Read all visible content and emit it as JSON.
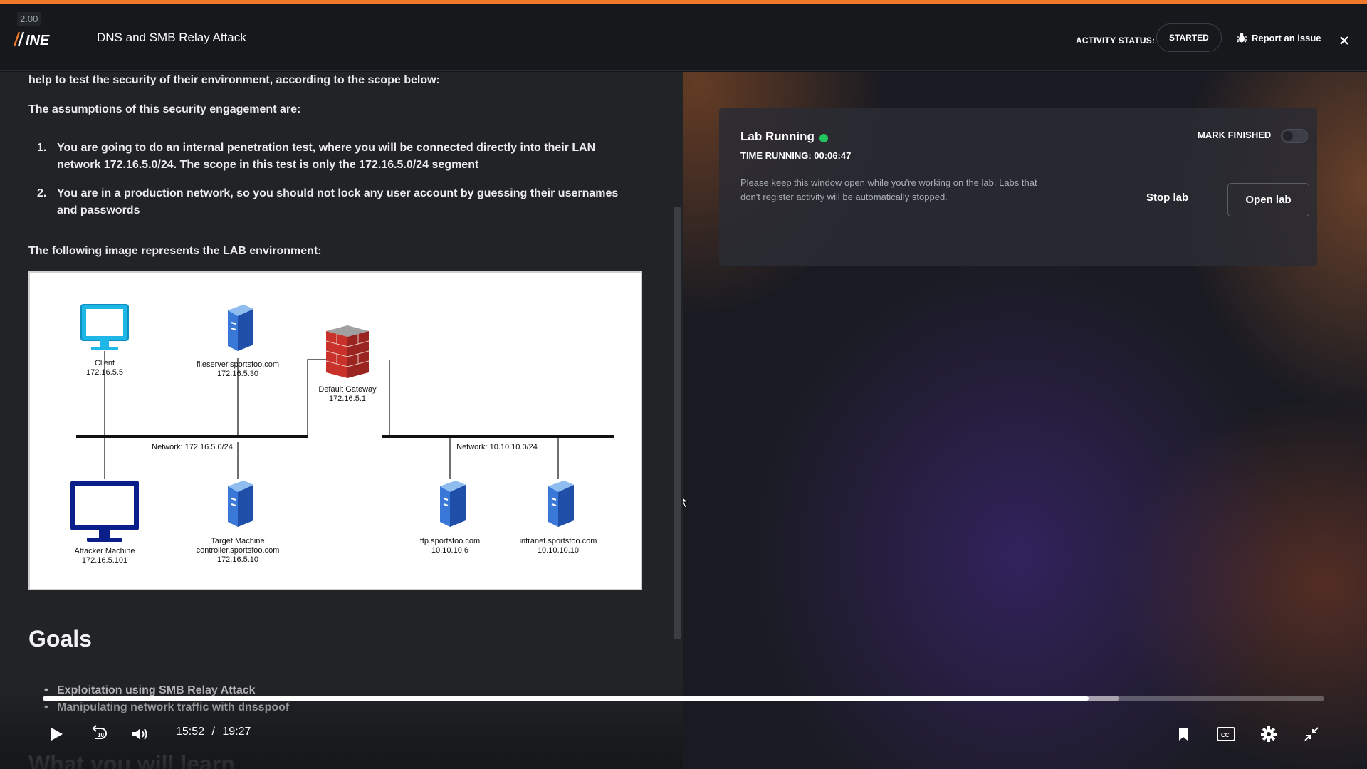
{
  "player": {
    "speed": "2.00",
    "current_time": "15:52",
    "separator": "/",
    "duration": "19:27",
    "progress_fraction": 0.816,
    "buffer_fraction": 0.84
  },
  "header": {
    "logo_text": "INE",
    "title": "DNS and SMB Relay Attack",
    "activity_label": "ACTIVITY STATUS:",
    "activity_status": "STARTED",
    "report_label": "Report an issue"
  },
  "content": {
    "intro": "help to test the security of their environment, according to the scope below:",
    "assumptions_heading": "The assumptions of this security engagement are:",
    "assumptions": [
      {
        "num": "1.",
        "before": "You are going to do an internal penetration test, where you will be connected directly into their LAN network ",
        "strong1": "172.16.5.0/24",
        "middle": ". The scope in this test is only the ",
        "strong2": "172.16.5.0/24",
        "after": " segment"
      },
      {
        "num": "2.",
        "text": "You are in a production network, so you should not lock any user account by guessing their usernames and passwords"
      }
    ],
    "following": "The following image represents the LAB environment:",
    "goals_heading": "Goals",
    "goals": [
      {
        "before": "Exploitation using ",
        "strong": "SMB Relay Attack"
      },
      {
        "before": "Manipulating network traffic with ",
        "strong": "dnsspoof"
      }
    ],
    "learn_heading": "What you will learn"
  },
  "diagram": {
    "client": {
      "name": "Client",
      "ip": "172.16.5.5"
    },
    "fileserver": {
      "name": "fileserver.sportsfoo.com",
      "ip": "172.16.5.30"
    },
    "gateway": {
      "name": "Default Gateway",
      "ip": "172.16.5.1"
    },
    "network_left": "Network: 172.16.5.0/24",
    "network_right": "Network: 10.10.10.0/24",
    "attacker": {
      "name": "Attacker Machine",
      "ip": "172.16.5.101"
    },
    "target": {
      "name": "Target Machine",
      "host": "controller.sportsfoo.com",
      "ip": "172.16.5.10"
    },
    "ftp": {
      "name": "ftp.sportsfoo.com",
      "ip": "10.10.10.6"
    },
    "intranet": {
      "name": "intranet.sportsfoo.com",
      "ip": "10.10.10.10"
    }
  },
  "lab": {
    "status_title": "Lab Running",
    "time_running": "TIME RUNNING: 00:06:47",
    "notice": "Please keep this window open while you're working on the lab. Labs that don't register activity will be automatically stopped.",
    "mark_finished": "MARK FINISHED",
    "mark_finished_on": false,
    "stop_label": "Stop lab",
    "open_label": "Open lab",
    "status_color": "#22c55e"
  },
  "colors": {
    "accent": "#f07a2a",
    "background": "#121418"
  }
}
